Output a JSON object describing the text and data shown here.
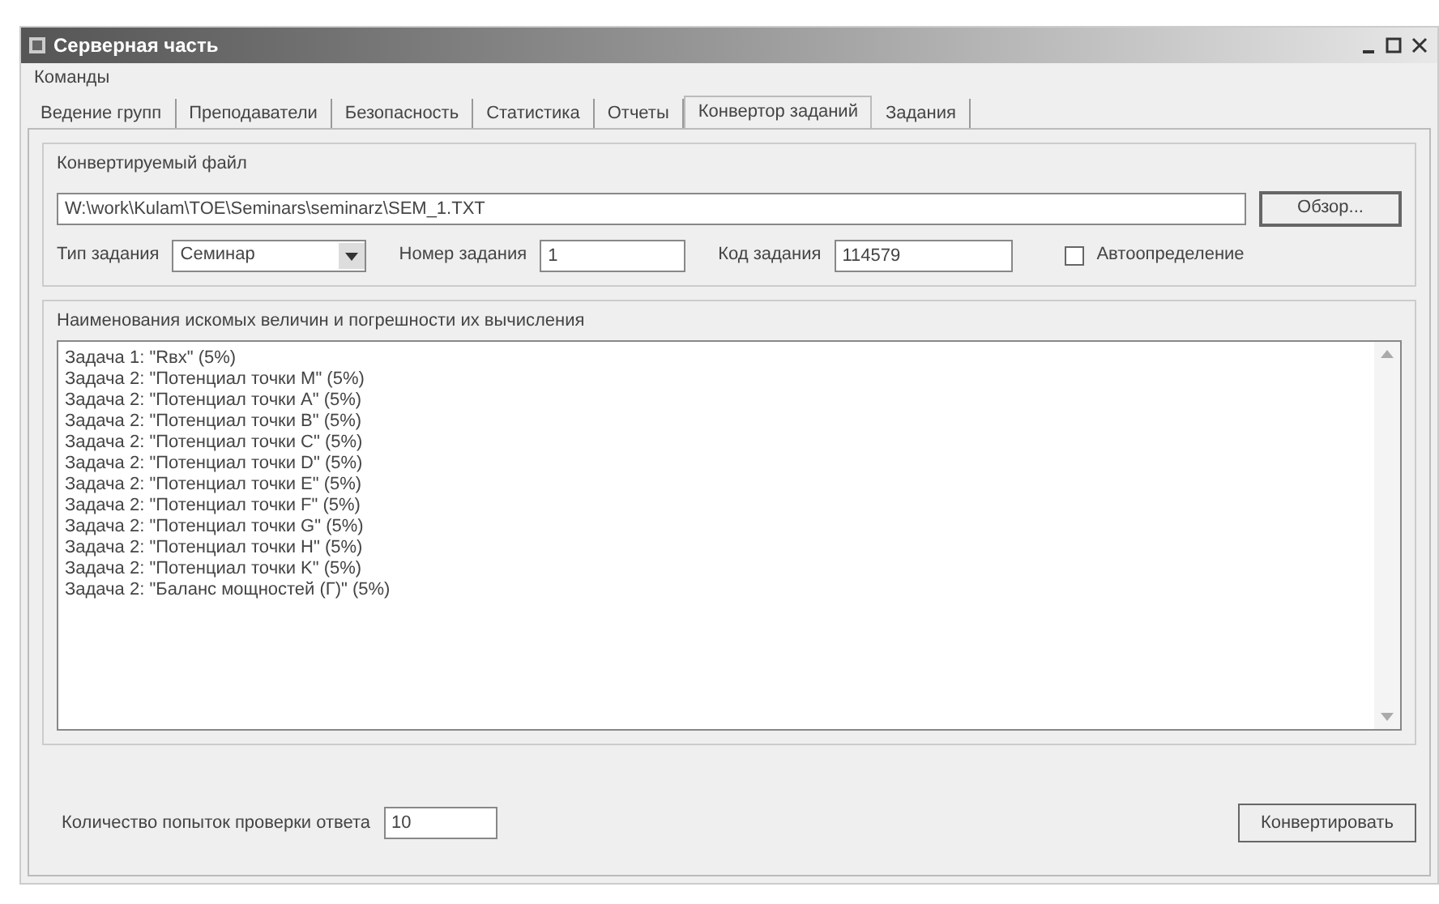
{
  "window": {
    "title": "Серверная часть"
  },
  "menu": [
    "Команды"
  ],
  "tabs": [
    {
      "label": "Ведение групп",
      "selected": false
    },
    {
      "label": "Преподаватели",
      "selected": false
    },
    {
      "label": "Безопасность",
      "selected": false
    },
    {
      "label": "Статистика",
      "selected": false
    },
    {
      "label": "Отчеты",
      "selected": false
    },
    {
      "label": "Конвертор заданий",
      "selected": true
    },
    {
      "label": "Задания",
      "selected": false
    }
  ],
  "file_group": {
    "title": "Конвертируемый файл",
    "path": "W:\\work\\Kulam\\TOE\\Seminars\\seminarz\\SEM_1.TXT",
    "browse_button": "Обзор..."
  },
  "task_type": {
    "label": "Тип задания",
    "value": "Семинар"
  },
  "task_number": {
    "label": "Номер задания",
    "value": "1"
  },
  "task_code": {
    "label": "Код задания",
    "value": "114579"
  },
  "auto_detect": {
    "label": "Автоопределение",
    "checked": false
  },
  "quantities_group": {
    "title": "Наименования искомых величин и погрешности их вычисления",
    "lines": [
      "Задача 1: \"Rвх\" (5%)",
      "Задача 2: \"Потенциал точки M\" (5%)",
      "Задача 2: \"Потенциал точки A\" (5%)",
      "Задача 2: \"Потенциал точки B\" (5%)",
      "Задача 2: \"Потенциал точки C\" (5%)",
      "Задача 2: \"Потенциал точки D\" (5%)",
      "Задача 2: \"Потенциал точки E\" (5%)",
      "Задача 2: \"Потенциал точки F\" (5%)",
      "Задача 2: \"Потенциал точки G\" (5%)",
      "Задача 2: \"Потенциал точки H\" (5%)",
      "Задача 2: \"Потенциал точки K\" (5%)",
      "Задача 2: \"Баланс мощностей (Г)\" (5%)"
    ]
  },
  "attempts": {
    "label": "Количество попыток проверки ответа",
    "value": "10"
  },
  "convert_button": "Конвертировать"
}
